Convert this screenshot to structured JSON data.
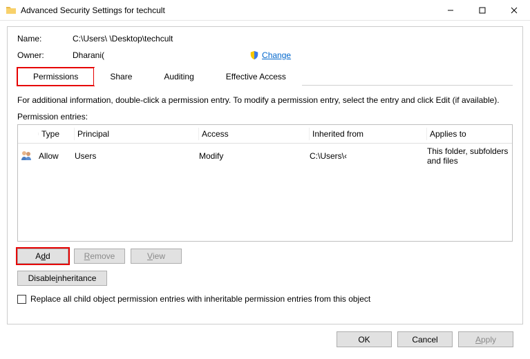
{
  "titlebar": {
    "title": "Advanced Security Settings for techcult"
  },
  "info": {
    "name_label": "Name:",
    "name_value": "C:\\Users\\                          \\Desktop\\techcult",
    "owner_label": "Owner:",
    "owner_value": "Dharani(",
    "change_label": "Change"
  },
  "tabs": {
    "permissions": "Permissions",
    "share": "Share",
    "auditing": "Auditing",
    "effective": "Effective Access"
  },
  "instruction": "For additional information, double-click a permission entry. To modify a permission entry, select the entry and click Edit (if available).",
  "entries_label": "Permission entries:",
  "table": {
    "headers": {
      "blank": "",
      "type": "Type",
      "principal": "Principal",
      "access": "Access",
      "inherited": "Inherited from",
      "applies": "Applies to"
    },
    "rows": [
      {
        "type": "Allow",
        "principal": "Users",
        "access": "Modify",
        "inherited": "C:\\Users\\‹",
        "applies": "This folder, subfolders and files"
      }
    ]
  },
  "buttons": {
    "add": "Add",
    "remove": "Remove",
    "view": "View",
    "disable_inheritance": "Disable inheritance",
    "ok": "OK",
    "cancel": "Cancel",
    "apply": "Apply"
  },
  "checkbox_label": "Replace all child object permission entries with inheritable permission entries from this object"
}
